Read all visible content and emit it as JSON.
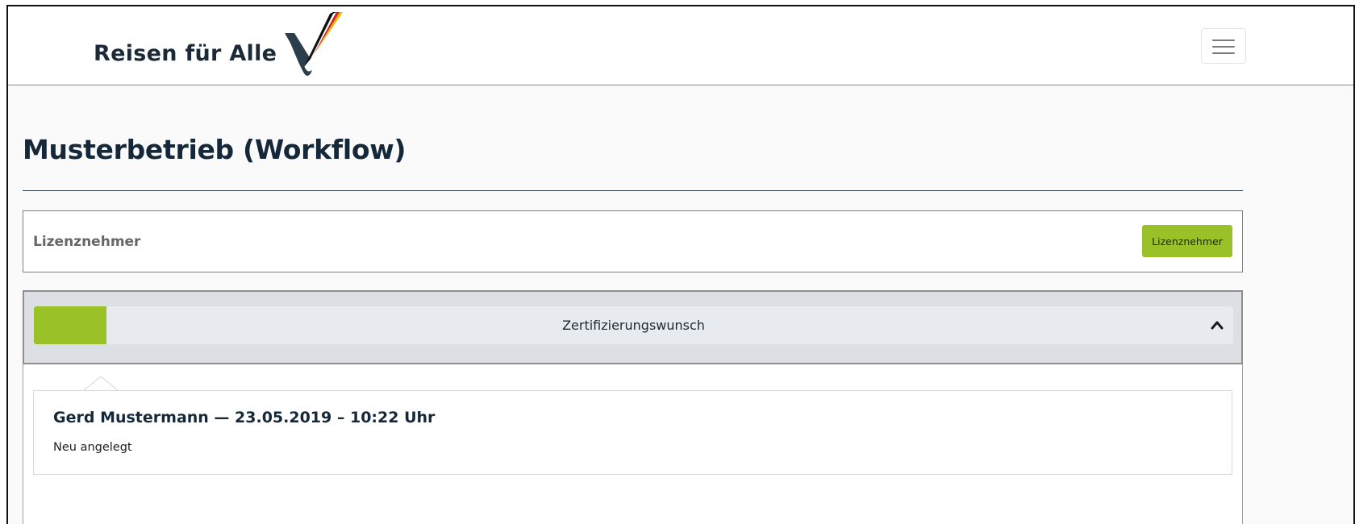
{
  "header": {
    "brand_text": "Reisen für Alle",
    "logo_icon": "checkmark-flag-logo-icon",
    "menu_icon": "hamburger-menu-icon"
  },
  "page": {
    "title": "Musterbetrieb (Workflow)"
  },
  "license_section": {
    "label": "Lizenznehmer",
    "button_label": "Lizenznehmer"
  },
  "workflow": {
    "accordion_title": "Zertifizierungswunsch",
    "expanded": true,
    "toggle_icon": "chevron-up-icon",
    "entries": [
      {
        "header": "Gerd Mustermann — 23.05.2019 – 10:22 Uhr",
        "status": "Neu angelegt"
      }
    ]
  },
  "colors": {
    "accent_green": "#9bc128",
    "title_navy": "#14283a",
    "navbar_rule": "#6a8fa0",
    "accordion_bg": "#dcdfe3"
  }
}
